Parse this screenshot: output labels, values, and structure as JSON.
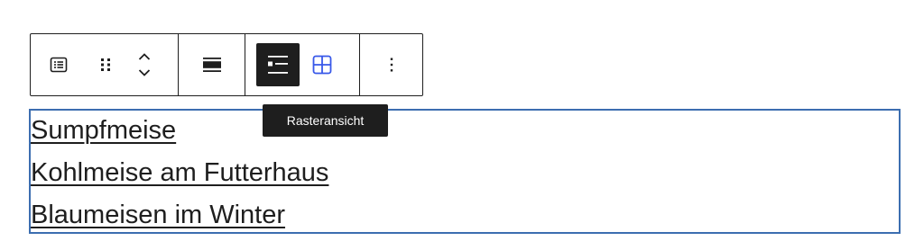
{
  "toolbar": {
    "block_type_icon": "list-block-icon",
    "drag_handle_icon": "drag-handle-icon",
    "move_up_icon": "chevron-up-icon",
    "move_down_icon": "chevron-down-icon",
    "align_icon": "align-wide-icon",
    "list_view_icon": "list-view-icon",
    "grid_view_icon": "grid-view-icon",
    "more_options_icon": "more-vertical-icon",
    "active_color": "#1e1e1e",
    "accent_color": "#3858e9"
  },
  "tooltip": {
    "text": "Rasteransicht"
  },
  "posts": [
    {
      "title": "Sumpfmeise"
    },
    {
      "title": "Kohlmeise am Futterhaus"
    },
    {
      "title": "Blaumeisen im Winter"
    }
  ],
  "block": {
    "selection_color": "#3c6eb0"
  }
}
